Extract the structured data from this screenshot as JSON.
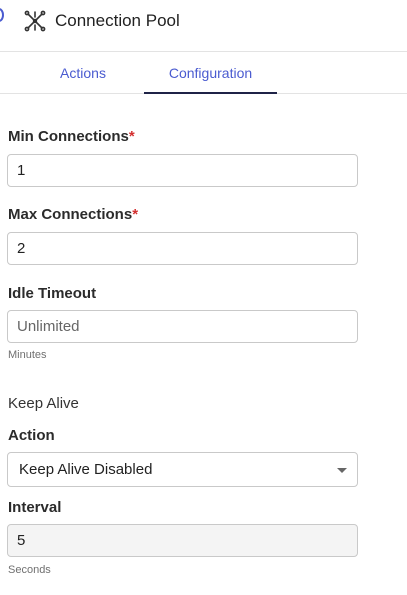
{
  "header": {
    "title": "Connection Pool",
    "icon": "network-nodes-icon"
  },
  "tabs": [
    {
      "label": "Actions",
      "active": false
    },
    {
      "label": "Configuration",
      "active": true
    }
  ],
  "form": {
    "min_connections": {
      "label": "Min Connections",
      "required_mark": "*",
      "value": "1"
    },
    "max_connections": {
      "label": "Max Connections",
      "required_mark": "*",
      "value": "2"
    },
    "idle_timeout": {
      "label": "Idle Timeout",
      "placeholder": "Unlimited",
      "hint": "Minutes"
    },
    "keep_alive": {
      "section_label": "Keep Alive",
      "action": {
        "label": "Action",
        "selected": "Keep Alive Disabled"
      },
      "interval": {
        "label": "Interval",
        "value": "5",
        "hint": "Seconds",
        "disabled": true
      }
    }
  },
  "colors": {
    "accent": "#4a5bd0",
    "required": "#d32f2f",
    "tab_indicator": "#1f2347"
  }
}
